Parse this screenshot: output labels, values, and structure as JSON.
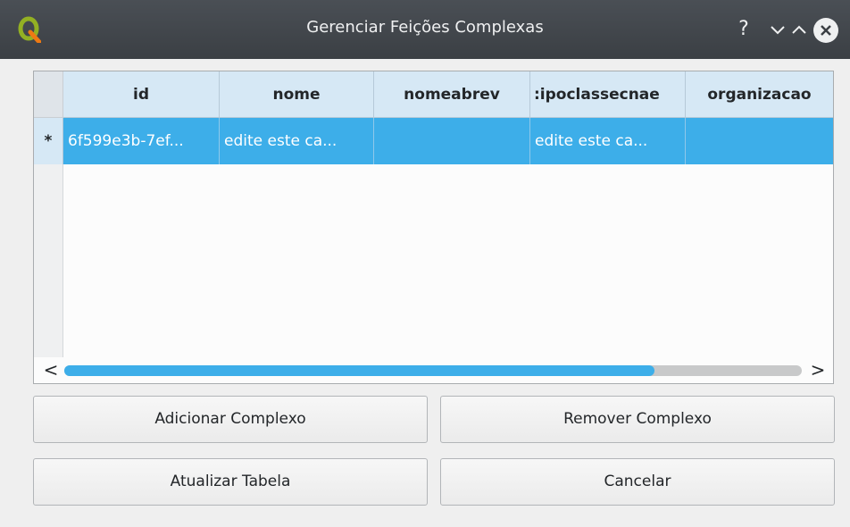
{
  "window": {
    "title": "Gerenciar Feições Complexas",
    "controls": {
      "help": "?",
      "minimize": "⌄",
      "maximize": "⌃",
      "close": "×"
    }
  },
  "table": {
    "columns": [
      "id",
      "nome",
      "nomeabrev",
      ":ipoclassecnae",
      "organizacao"
    ],
    "rows": [
      {
        "marker": "*",
        "cells": [
          "6f599e3b-7ef...",
          "edite este ca...",
          "",
          "edite este ca...",
          ""
        ]
      }
    ],
    "scrollbar": {
      "left_arrow": "<",
      "right_arrow": ">",
      "position_fraction": 0.8
    }
  },
  "buttons": {
    "add": "Adicionar Complexo",
    "remove": "Remover Complexo",
    "refresh": "Atualizar Tabela",
    "cancel": "Cancelar"
  },
  "colors": {
    "titlebar": "#3b3f44",
    "selection": "#3daee9",
    "header": "#d6e8f5",
    "background": "#efefef"
  }
}
